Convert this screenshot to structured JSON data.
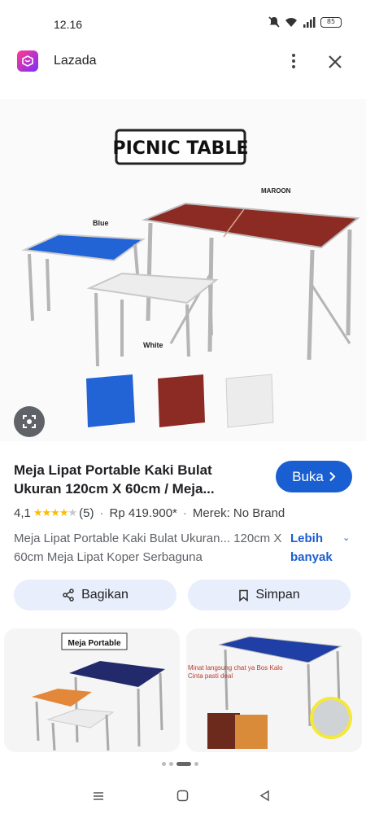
{
  "status_bar": {
    "time": "12.16",
    "battery": "85"
  },
  "app": {
    "name": "Lazada",
    "icon": "lazada-logo-icon"
  },
  "hero_image": {
    "sign_text": "PICNIC TABLE",
    "labels": {
      "maroon": "MAROON",
      "blue": "Blue",
      "white": "White"
    },
    "colors": {
      "maroon": "#8b2b24",
      "blue": "#2264d6",
      "white": "#ececec"
    }
  },
  "result": {
    "title": "Meja Lipat Portable Kaki Bulat Ukuran 120cm X 60cm / Meja...",
    "visit_label": "Buka",
    "rating": "4,1",
    "stars": 4,
    "review_count": "(5)",
    "price": "Rp 419.900*",
    "brand": "Merek: No Brand",
    "description": "Meja Lipat Portable Kaki Bulat Ukuran... 120cm X 60cm Meja Lipat Koper Serbaguna",
    "more_label": "Lebih banyak"
  },
  "actions": {
    "share_label": "Bagikan",
    "save_label": "Simpan"
  },
  "related": [
    {
      "caption": "Meja Portable"
    },
    {
      "caption": "Minat langsung chat ya Bos Kalo Cinta pasti deal"
    }
  ],
  "carousel": {
    "count": 4,
    "active_index": 2
  }
}
